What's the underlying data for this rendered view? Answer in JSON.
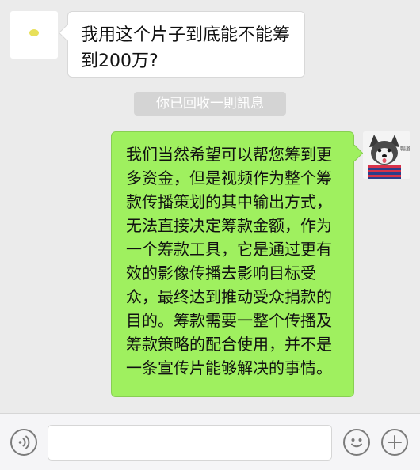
{
  "chat": {
    "incoming": {
      "text": "我用这个片子到底能不能筹到200万?"
    },
    "notice": {
      "text": "你已回收一則訊息"
    },
    "outgoing": {
      "text": "我们当然希望可以帮您筹到更多资金，但是视频作为整个筹款传播策划的其中输出方式，无法直接决定筹款金额，作为一个筹款工具，它是通过更有效的影像传播去影响目标受众，最终达到推动受众捐款的目的。筹款需要一整个传播及筹款策略的配合使用，并不是一条宣传片能够解决的事情。"
    },
    "outgoing_avatar": {
      "caption": "暢麗"
    }
  },
  "input_bar": {
    "voice_icon": "voice-icon",
    "emoji_icon": "emoji-icon",
    "plus_icon": "plus-icon"
  },
  "colors": {
    "background": "#ebebeb",
    "incoming_bubble": "#ffffff",
    "outgoing_bubble": "#9ff05f",
    "notice_background": "#d4d4d4",
    "input_bar": "#f5f5f7"
  }
}
